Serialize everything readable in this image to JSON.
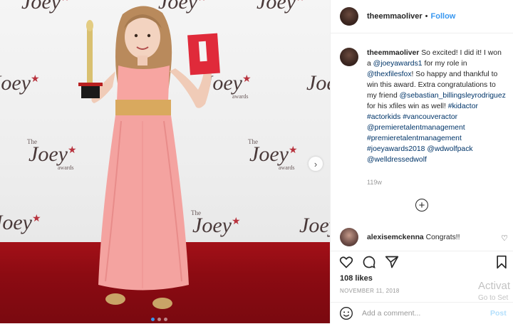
{
  "photo": {
    "backdrop_logo": {
      "the": "The",
      "name": "Joey",
      "awards": "awards"
    },
    "next_glyph": "›",
    "carousel_dots": 3
  },
  "header": {
    "username": "theemmaoliver",
    "separator": "•",
    "follow_label": "Follow"
  },
  "caption": {
    "username": "theemmaoliver",
    "parts": [
      {
        "t": "So excited! I did it! I won a ",
        "link": false
      },
      {
        "t": "@joeyawards1",
        "link": true
      },
      {
        "t": " for my role in ",
        "link": false
      },
      {
        "t": "@thexfilesfox",
        "link": true
      },
      {
        "t": "! So happy and thankful to win this award. Extra congratulations to my friend ",
        "link": false
      },
      {
        "t": "@sebastian_billingsleyrodriguez",
        "link": true
      },
      {
        "t": " for his xfiles win as well! ",
        "link": false
      },
      {
        "t": "#kidactor",
        "link": true
      },
      {
        "t": " ",
        "link": false
      },
      {
        "t": "#actorkids",
        "link": true
      },
      {
        "t": " ",
        "link": false
      },
      {
        "t": "#vancouveractor",
        "link": true
      },
      {
        "t": " ",
        "link": false
      },
      {
        "t": "@premieretalentmanagement",
        "link": true
      },
      {
        "t": " ",
        "link": false
      },
      {
        "t": "#premieretalentmanagement",
        "link": true
      },
      {
        "t": " ",
        "link": false
      },
      {
        "t": "#joeyawards2018",
        "link": true
      },
      {
        "t": " ",
        "link": false
      },
      {
        "t": "@wdwolfpack",
        "link": true
      },
      {
        "t": " ",
        "link": false
      },
      {
        "t": "@welldressedwolf",
        "link": true
      }
    ],
    "age": "119w"
  },
  "load_more_glyph": "+",
  "comment": {
    "username": "alexisemckenna",
    "text": "Congrats!!",
    "heart_glyph": "♡"
  },
  "likes": "108 likes",
  "date": "NOVEMBER 11, 2018",
  "add_comment": {
    "placeholder": "Add a comment...",
    "post_label": "Post"
  },
  "watermark": {
    "line1": "Activat",
    "line2": "Go to Set"
  },
  "colors": {
    "link": "#003569",
    "follow": "#3897f0",
    "carpet": "#a31018",
    "dress": "#f4a3a0"
  },
  "icons": [
    "heart-icon",
    "comment-icon",
    "share-icon",
    "bookmark-icon",
    "emoji-icon",
    "plus-circle-icon",
    "chevron-right-icon"
  ]
}
